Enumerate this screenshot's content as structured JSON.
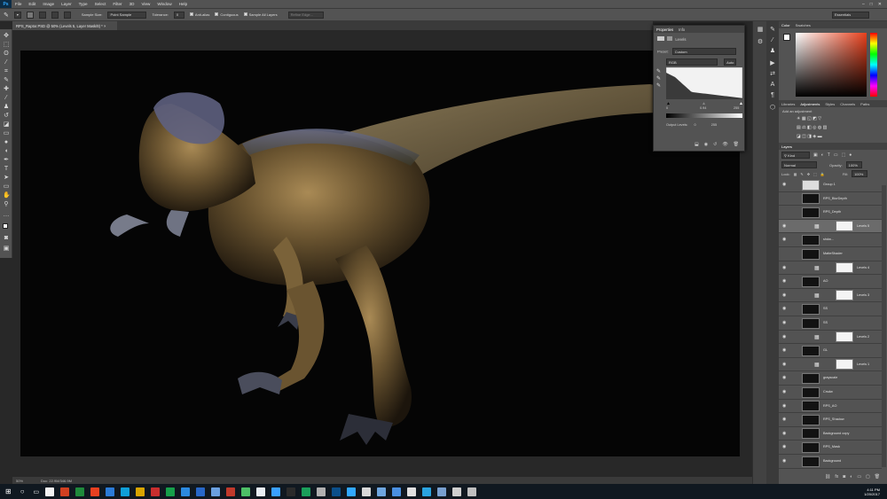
{
  "app": {
    "logo": "Ps",
    "accent": "#31a8ff"
  },
  "menu": [
    "File",
    "Edit",
    "Image",
    "Layer",
    "Type",
    "Select",
    "Filter",
    "3D",
    "View",
    "Window",
    "Help"
  ],
  "window_controls": [
    "–",
    "□",
    "✕"
  ],
  "options": {
    "sample_size_label": "Sample Size:",
    "sample_size_value": "Point Sample",
    "tolerance_label": "Tolerance:",
    "tolerance_value": "0",
    "anti_alias": "Anti-alias",
    "contiguous": "Contiguous",
    "sample_all": "Sample All Layers",
    "refine": "Refine Edge...",
    "workspace": "Essentials"
  },
  "document_tab": "RPS_Raptor.PSD @ 50% (Levels 5, Layer Mask/8) *",
  "status": {
    "zoom": "50%",
    "doc": "Doc: 22.9M/346.9M"
  },
  "properties": {
    "tabs": [
      "Properties",
      "Info"
    ],
    "title": "Levels",
    "preset_label": "Preset:",
    "preset_value": "Custom",
    "channel": "RGB",
    "auto": "Auto",
    "input_vals": [
      "0",
      "0.94",
      "255"
    ],
    "output_label": "Output Levels:",
    "output_vals": [
      "0",
      "255"
    ],
    "histogram_color": "#dcdcdc"
  },
  "color_panel": {
    "tabs": [
      "Color",
      "Swatches"
    ],
    "hue_color": "#e8401c"
  },
  "adjustments": {
    "tabs": [
      "Libraries",
      "Adjustments",
      "Styles",
      "Channels",
      "Paths"
    ],
    "hint": "Add an adjustment"
  },
  "layers_panel": {
    "title": "Layers",
    "kind": "Kind",
    "blend": "Normal",
    "opacity_label": "Opacity:",
    "opacity": "100%",
    "lock_label": "Lock:",
    "fill_label": "Fill:",
    "fill": "100%",
    "rows": [
      {
        "name": "Group 1",
        "type": "group",
        "eye": true
      },
      {
        "name": "RPS_BlurDepth",
        "type": "image",
        "eye": false
      },
      {
        "name": "RPS_Depth",
        "type": "image",
        "eye": false
      },
      {
        "name": "Levels 5",
        "type": "adj",
        "eye": true,
        "selected": true
      },
      {
        "name": "shdw...",
        "type": "image",
        "eye": true
      },
      {
        "name": "MatteShader",
        "type": "image",
        "eye": false
      },
      {
        "name": "Levels 4",
        "type": "adj",
        "eye": true
      },
      {
        "name": "AO",
        "type": "image",
        "eye": true
      },
      {
        "name": "Levels 3",
        "type": "adj",
        "eye": true
      },
      {
        "name": "SS",
        "type": "image",
        "eye": true
      },
      {
        "name": "SS",
        "type": "image",
        "eye": true
      },
      {
        "name": "Levels 2",
        "type": "adj",
        "eye": true
      },
      {
        "name": "GL",
        "type": "image",
        "eye": true
      },
      {
        "name": "Levels 1",
        "type": "adj",
        "eye": true
      },
      {
        "name": "grayscale",
        "type": "image",
        "eye": true
      },
      {
        "name": "Crsdw",
        "type": "image",
        "eye": true
      },
      {
        "name": "RPS_AO",
        "type": "image",
        "eye": true
      },
      {
        "name": "RPS_Shadow",
        "type": "image",
        "eye": true
      },
      {
        "name": "Background copy",
        "type": "image",
        "eye": true
      },
      {
        "name": "RPS_Mask",
        "type": "image",
        "eye": true
      },
      {
        "name": "Background",
        "type": "image",
        "eye": true
      }
    ]
  },
  "taskbar": {
    "time": "4:11 PM",
    "date": "1/20/2017",
    "icons": [
      "#f2f2f2",
      "#d04020",
      "#1f8a3b",
      "#e84020",
      "#2b7bd8",
      "#0f9fd8",
      "#d9a500",
      "#c82e2e",
      "#16a04a",
      "#2b8ae0",
      "#2867c8",
      "#6aa0e0",
      "#c0392b",
      "#4dbf66",
      "#e8eef4",
      "#3aa0ff",
      "#2b2b2b",
      "#1a9f5a",
      "#b0b0b0",
      "#0b4f8a",
      "#31a8ff",
      "#d8d8d8",
      "#6ea6e0",
      "#4a90e2",
      "#e0e0e0",
      "#2aa3e0",
      "#78a0d0",
      "#cfcfcf",
      "#bfbfbf"
    ]
  }
}
